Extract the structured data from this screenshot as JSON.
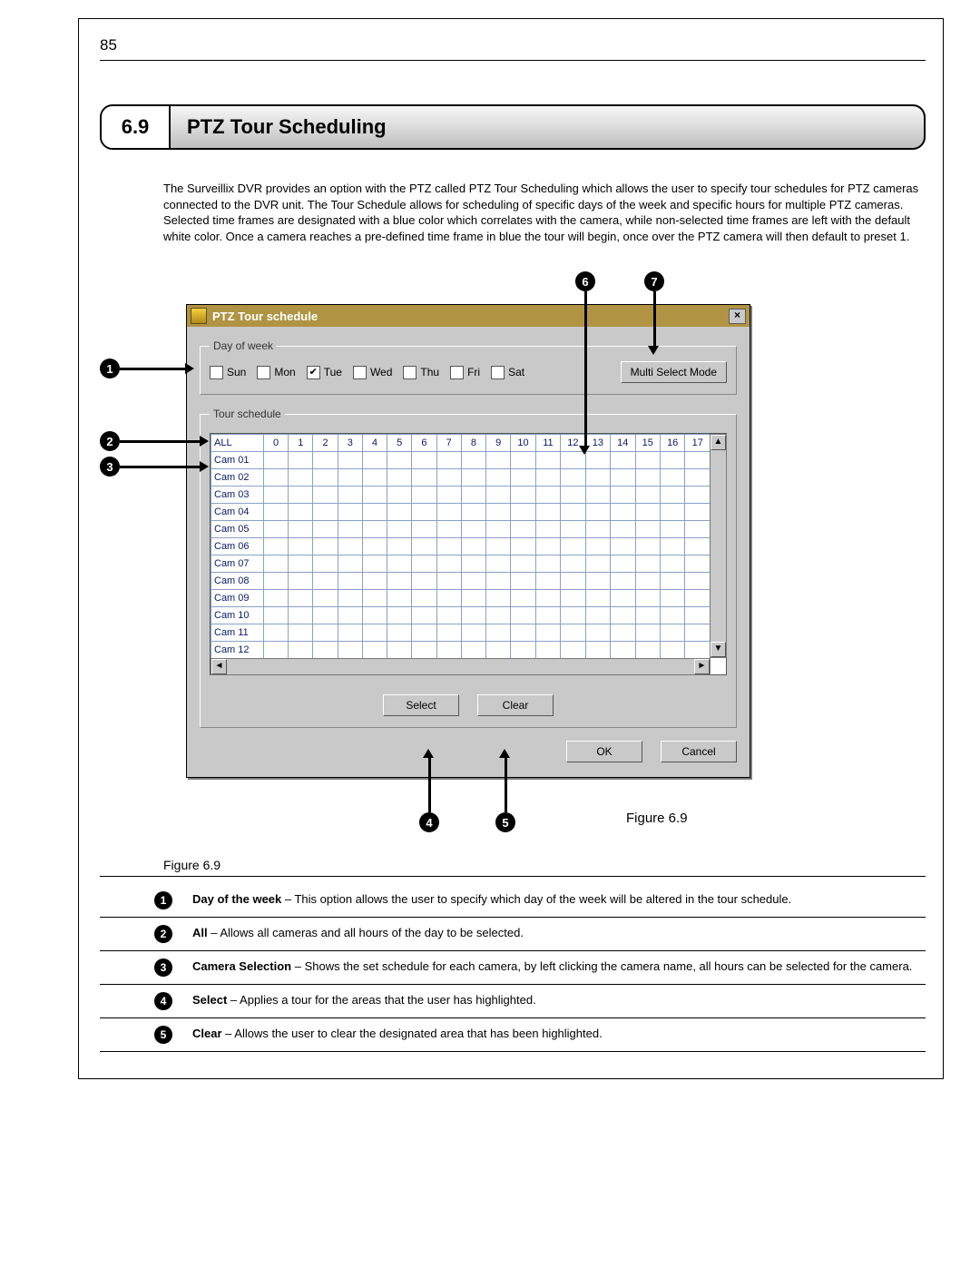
{
  "page": {
    "number": "85"
  },
  "section": {
    "number": "6.9",
    "title": "PTZ Tour Scheduling"
  },
  "intro": "The Surveillix DVR provides an option with the PTZ called PTZ Tour Scheduling which allows the user to specify tour schedules for PTZ cameras connected to the DVR unit. The Tour Schedule allows for scheduling of specific days of the week and specific hours for multiple PTZ cameras. Selected time frames are designated with a blue color which correlates with the camera, while non-selected time frames are left with the default white color. Once a camera reaches a pre-defined time frame in blue the tour will begin, once over the PTZ camera will then default to preset 1.",
  "dialog": {
    "title": "PTZ Tour schedule",
    "close": "×",
    "day_legend": "Day of week",
    "days": [
      "Sun",
      "Mon",
      "Tue",
      "Wed",
      "Thu",
      "Fri",
      "Sat"
    ],
    "checked_day_index": 2,
    "multi_select": "Multi Select Mode",
    "schedule_legend": "Tour schedule",
    "hdr_all": "ALL",
    "hours": [
      "0",
      "1",
      "2",
      "3",
      "4",
      "5",
      "6",
      "7",
      "8",
      "9",
      "10",
      "11",
      "12",
      "13",
      "14",
      "15",
      "16",
      "17"
    ],
    "cams": [
      "Cam 01",
      "Cam 02",
      "Cam 03",
      "Cam 04",
      "Cam 05",
      "Cam 06",
      "Cam 07",
      "Cam 08",
      "Cam 09",
      "Cam 10",
      "Cam 11",
      "Cam 12"
    ],
    "buttons": {
      "select": "Select",
      "clear": "Clear",
      "ok": "OK",
      "cancel": "Cancel"
    }
  },
  "callouts": {
    "c1": "1",
    "c2": "2",
    "c3": "3",
    "c4": "4",
    "c5": "5",
    "c6": "6",
    "c7": "7"
  },
  "figure_caption": "Figure 6.9",
  "legend": [
    {
      "n": "1",
      "bold": "Day of the week",
      "text": " – This option allows the user to specify which day of the week will be altered in the tour schedule."
    },
    {
      "n": "2",
      "bold": "All",
      "text": " – Allows all cameras and all hours of the day to be selected."
    },
    {
      "n": "3",
      "bold": "Camera Selection",
      "text": " – Shows the set schedule for each camera, by left clicking the camera name, all hours can be selected for the camera."
    },
    {
      "n": "4",
      "bold": "Select",
      "text": " – Applies a tour for the areas that the user has highlighted."
    },
    {
      "n": "5",
      "bold": "Clear",
      "text": " – Allows the user to clear the designated area that has been highlighted."
    }
  ]
}
